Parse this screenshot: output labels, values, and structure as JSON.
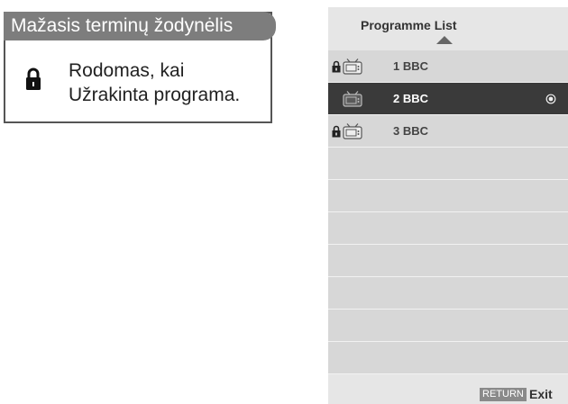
{
  "glossary": {
    "title": "Mažasis terminų žodynėlis",
    "icon": "lock-icon",
    "line1": "Rodomas, kai",
    "line2": "Užrakinta programa."
  },
  "programme_list": {
    "title": "Programme List",
    "rows": [
      {
        "label": "1 BBC",
        "locked": true,
        "icon": "tv-icon",
        "selected": false
      },
      {
        "label": "2 BBC",
        "locked": false,
        "icon": "tv-icon",
        "selected": true
      },
      {
        "label": "3 BBC",
        "locked": true,
        "icon": "tv-icon",
        "selected": false
      },
      {
        "label": "",
        "locked": false,
        "selected": false
      },
      {
        "label": "",
        "locked": false,
        "selected": false
      },
      {
        "label": "",
        "locked": false,
        "selected": false
      },
      {
        "label": "",
        "locked": false,
        "selected": false
      },
      {
        "label": "",
        "locked": false,
        "selected": false
      },
      {
        "label": "",
        "locked": false,
        "selected": false
      },
      {
        "label": "",
        "locked": false,
        "selected": false
      }
    ]
  },
  "footer": {
    "return_label": "RETURN",
    "exit_label": "Exit"
  },
  "colors": {
    "panel_bg": "#e6e6e6",
    "row_bg": "#d7d7d7",
    "selected_row_bg": "#3a3a3a",
    "glossary_header": "#7d7d7d"
  }
}
